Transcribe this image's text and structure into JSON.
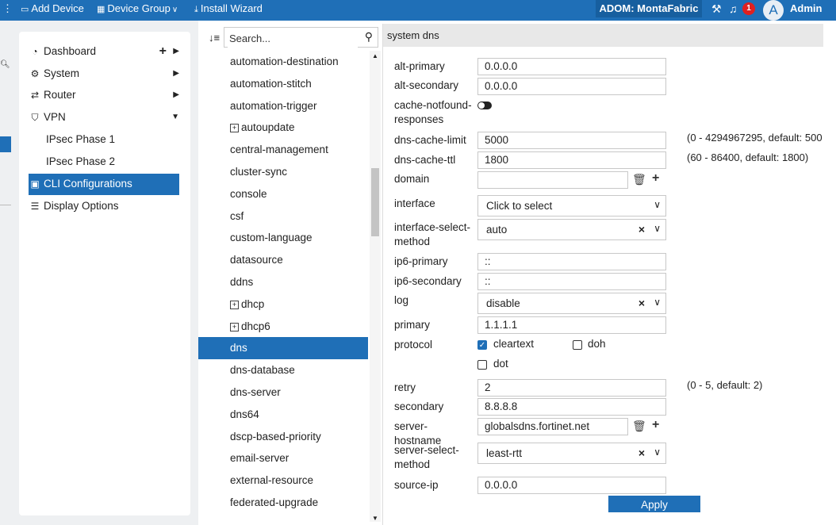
{
  "topbar": {
    "add_device": "Add Device",
    "device_group": "Device Group",
    "install_wizard": "Install Wizard",
    "adom": "ADOM: MontaFabric",
    "notifications": "1",
    "avatar_letter": "A",
    "user": "Admin"
  },
  "sidebar": {
    "dashboard": "Dashboard",
    "system": "System",
    "router": "Router",
    "vpn": "VPN",
    "ipsec1": "IPsec Phase 1",
    "ipsec2": "IPsec Phase 2",
    "cli": "CLI Configurations",
    "display": "Display Options"
  },
  "search": {
    "placeholder": "Search..."
  },
  "list": {
    "items": [
      {
        "label": "automation-destination"
      },
      {
        "label": "automation-stitch"
      },
      {
        "label": "automation-trigger"
      },
      {
        "label": "autoupdate",
        "expandable": true
      },
      {
        "label": "central-management"
      },
      {
        "label": "cluster-sync"
      },
      {
        "label": "console"
      },
      {
        "label": "csf"
      },
      {
        "label": "custom-language"
      },
      {
        "label": "datasource"
      },
      {
        "label": "ddns"
      },
      {
        "label": "dhcp",
        "expandable": true
      },
      {
        "label": "dhcp6",
        "expandable": true
      },
      {
        "label": "dns",
        "selected": true
      },
      {
        "label": "dns-database"
      },
      {
        "label": "dns-server"
      },
      {
        "label": "dns64"
      },
      {
        "label": "dscp-based-priority"
      },
      {
        "label": "email-server"
      },
      {
        "label": "external-resource"
      },
      {
        "label": "federated-upgrade"
      }
    ]
  },
  "form": {
    "title": "system dns",
    "alt_primary": {
      "label": "alt-primary",
      "value": "0.0.0.0"
    },
    "alt_secondary": {
      "label": "alt-secondary",
      "value": "0.0.0.0"
    },
    "cache_notfound": {
      "label": "cache-notfound-responses",
      "enabled": false
    },
    "dns_cache_limit": {
      "label": "dns-cache-limit",
      "value": "5000",
      "hint": "(0 - 4294967295, default: 500"
    },
    "dns_cache_ttl": {
      "label": "dns-cache-ttl",
      "value": "1800",
      "hint": "(60 - 86400, default: 1800)"
    },
    "domain": {
      "label": "domain",
      "value": ""
    },
    "interface": {
      "label": "interface",
      "value": "Click to select"
    },
    "interface_select_method": {
      "label": "interface-select-method",
      "value": "auto"
    },
    "ip6_primary": {
      "label": "ip6-primary",
      "value": "::"
    },
    "ip6_secondary": {
      "label": "ip6-secondary",
      "value": "::"
    },
    "log": {
      "label": "log",
      "value": "disable"
    },
    "primary": {
      "label": "primary",
      "value": "1.1.1.1"
    },
    "protocol": {
      "label": "protocol",
      "options": {
        "cleartext": "cleartext",
        "doh": "doh",
        "dot": "dot"
      },
      "checked": [
        "cleartext"
      ]
    },
    "retry": {
      "label": "retry",
      "value": "2",
      "hint": "(0 - 5, default: 2)"
    },
    "secondary": {
      "label": "secondary",
      "value": "8.8.8.8"
    },
    "server_hostname": {
      "label": "server-hostname",
      "value": "globalsdns.fortinet.net"
    },
    "server_select_method": {
      "label": "server-select-method",
      "value": "least-rtt"
    },
    "source_ip": {
      "label": "source-ip",
      "value": "0.0.0.0"
    },
    "apply": "Apply"
  }
}
